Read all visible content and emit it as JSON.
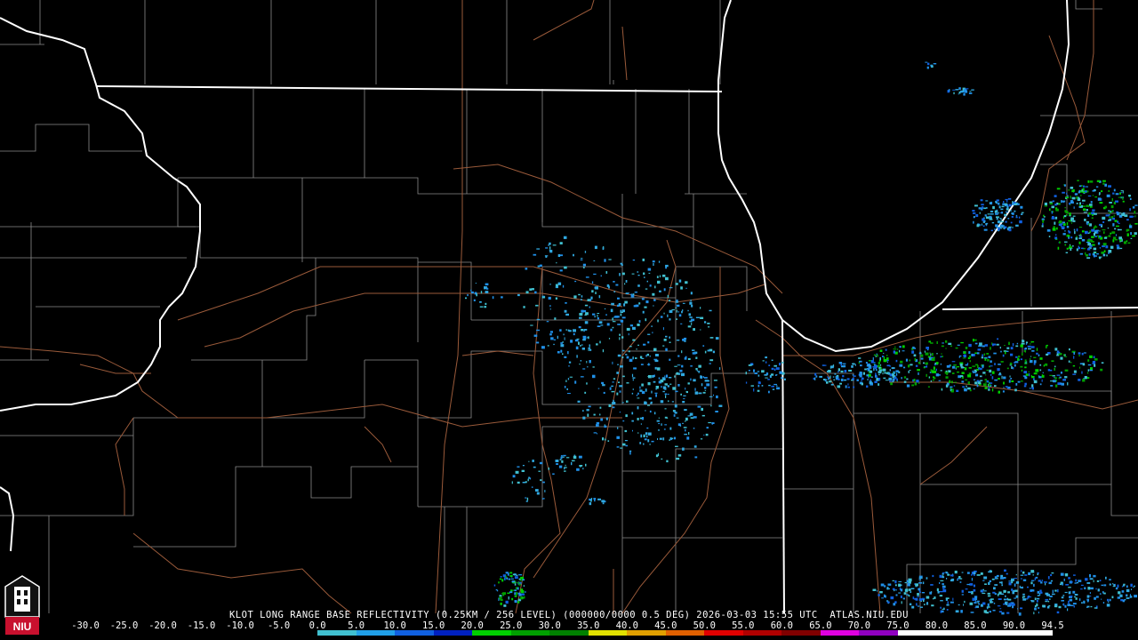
{
  "title": "KLOT LONG RANGE BASE REFLECTIVITY (0.25KM / 256 LEVEL) (000000/0000 0.5 DEG) 2026-03-03 15:55 UTC  ATLAS.NIU.EDU",
  "logo_text": "NIU",
  "scale_labels": [
    "-30.0",
    "-25.0",
    "-20.0",
    "-15.0",
    "-10.0",
    "-5.0",
    "0.0",
    "5.0",
    "10.0",
    "15.0",
    "20.0",
    "25.0",
    "30.0",
    "35.0",
    "40.0",
    "45.0",
    "50.0",
    "55.0",
    "60.0",
    "65.0",
    "70.0",
    "75.0",
    "80.0",
    "85.0",
    "90.0",
    "94.5"
  ],
  "colors": {
    "state_border": "#ffffff",
    "county_line": "#8a8a8a",
    "highway": "#9a5a3a",
    "scale": [
      "#000000",
      "#000000",
      "#000000",
      "#000000",
      "#000000",
      "#000000",
      "#40c0d0",
      "#20a0e8",
      "#1060e0",
      "#0020c0",
      "#00d000",
      "#00a000",
      "#008000",
      "#e0e000",
      "#e0a000",
      "#e06000",
      "#e00000",
      "#b00000",
      "#800000",
      "#e000e0",
      "#9000c0",
      "#ffffff",
      "#ffffff",
      "#ffffff",
      "#ffffff"
    ]
  }
}
